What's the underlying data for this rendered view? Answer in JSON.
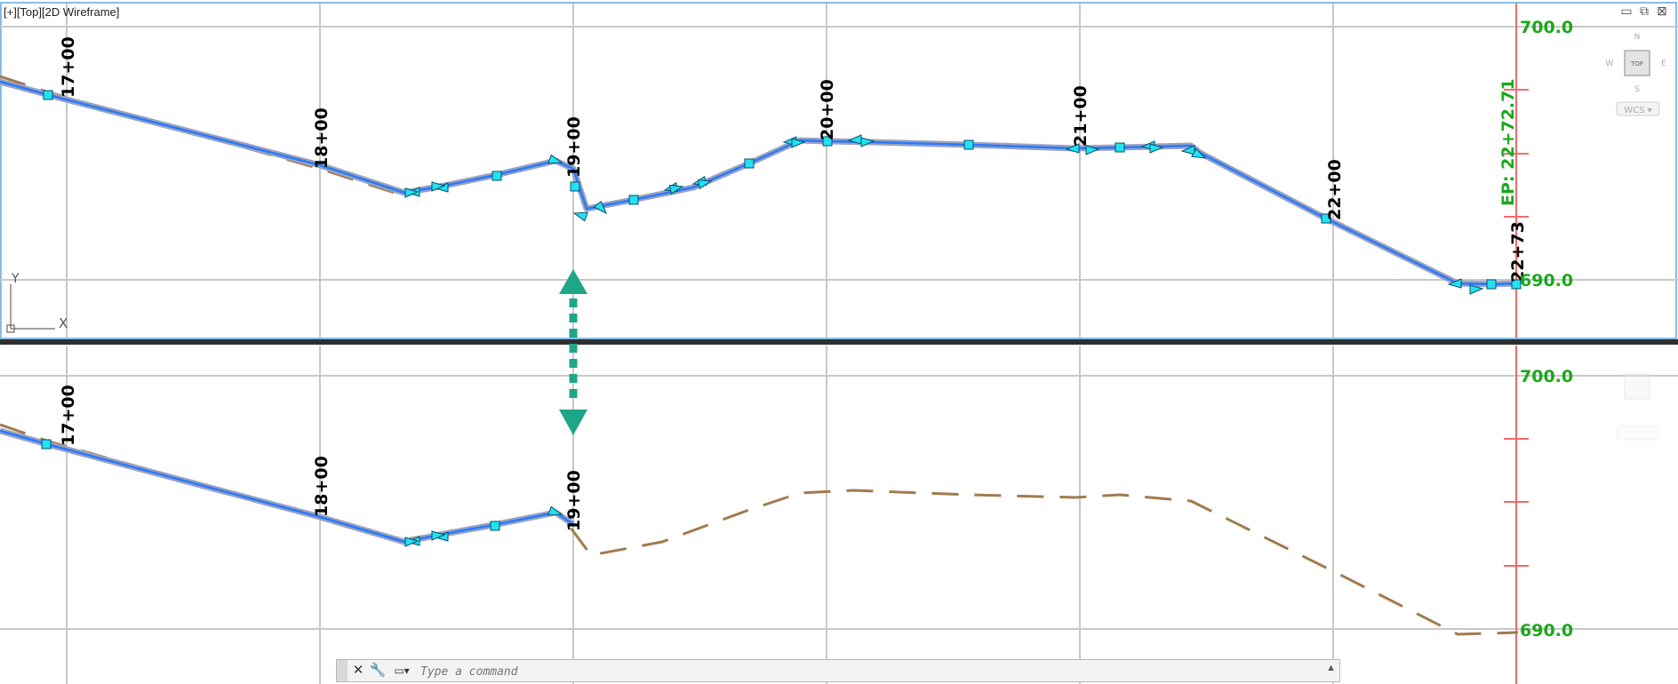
{
  "viewport_label": "[+][Top][2D Wireframe]",
  "window_controls": {
    "minimize": "▭",
    "restore": "⧉",
    "close": "⊠"
  },
  "viewcube": {
    "top_face": "TOP",
    "north": "N",
    "south": "S",
    "east": "E",
    "west": "W",
    "wcs": "WCS ▾"
  },
  "ucs": {
    "x": "X",
    "y": "Y"
  },
  "elevations": {
    "upper": "700.0",
    "lower": "690.0"
  },
  "endpoint_label": "EP:  22+72.71",
  "endpoint_station": "22+73",
  "stations": [
    "17+00",
    "18+00",
    "19+00",
    "20+00",
    "21+00",
    "22+00"
  ],
  "command_line": {
    "placeholder": "Type a command"
  },
  "colors": {
    "grid": "#c8c8c8",
    "profile": "#2979ff",
    "ground": "#a27a4e",
    "grip": "#00e5ee",
    "axis_red": "#f36a6a",
    "elev_text": "#1aa81a",
    "arrow": "#1fa587",
    "viewport_border": "#87bde8"
  }
}
